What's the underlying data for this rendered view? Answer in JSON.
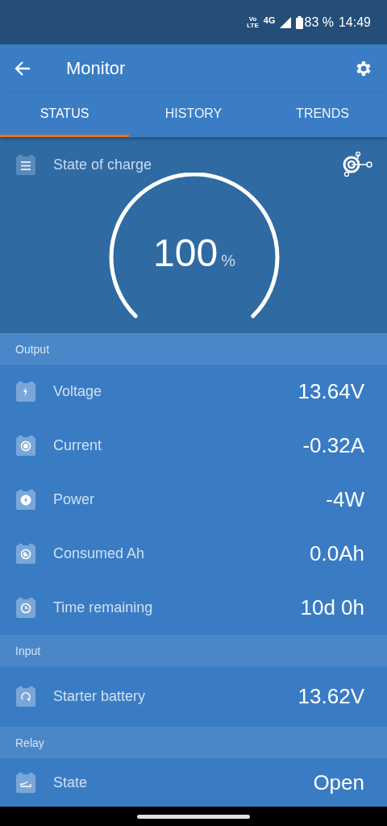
{
  "status_bar": {
    "network_badge": [
      "Vo",
      "LTE"
    ],
    "network": "4G",
    "battery": "83 %",
    "time": "14:49"
  },
  "app_bar": {
    "title": "Monitor"
  },
  "tabs": [
    {
      "label": "STATUS",
      "selected": true
    },
    {
      "label": "HISTORY",
      "selected": false
    },
    {
      "label": "TRENDS",
      "selected": false
    }
  ],
  "gauge": {
    "label": "State of charge",
    "value": "100",
    "unit": "%"
  },
  "sections": [
    {
      "title": "Output",
      "rows": [
        {
          "kind": "bolt",
          "label": "Voltage",
          "value": "13.64V"
        },
        {
          "kind": "ring",
          "label": "Current",
          "value": "-0.32A"
        },
        {
          "kind": "bolt-circle",
          "label": "Power",
          "value": "-4W"
        },
        {
          "kind": "moon",
          "label": "Consumed Ah",
          "value": "0.0Ah"
        },
        {
          "kind": "clock",
          "label": "Time remaining",
          "value": "10d 0h"
        }
      ]
    },
    {
      "title": "Input",
      "rows": [
        {
          "kind": "loop",
          "label": "Starter battery",
          "value": "13.62V"
        }
      ]
    },
    {
      "title": "Relay",
      "rows": [
        {
          "kind": "switch",
          "label": "State",
          "value": "Open"
        }
      ]
    }
  ]
}
